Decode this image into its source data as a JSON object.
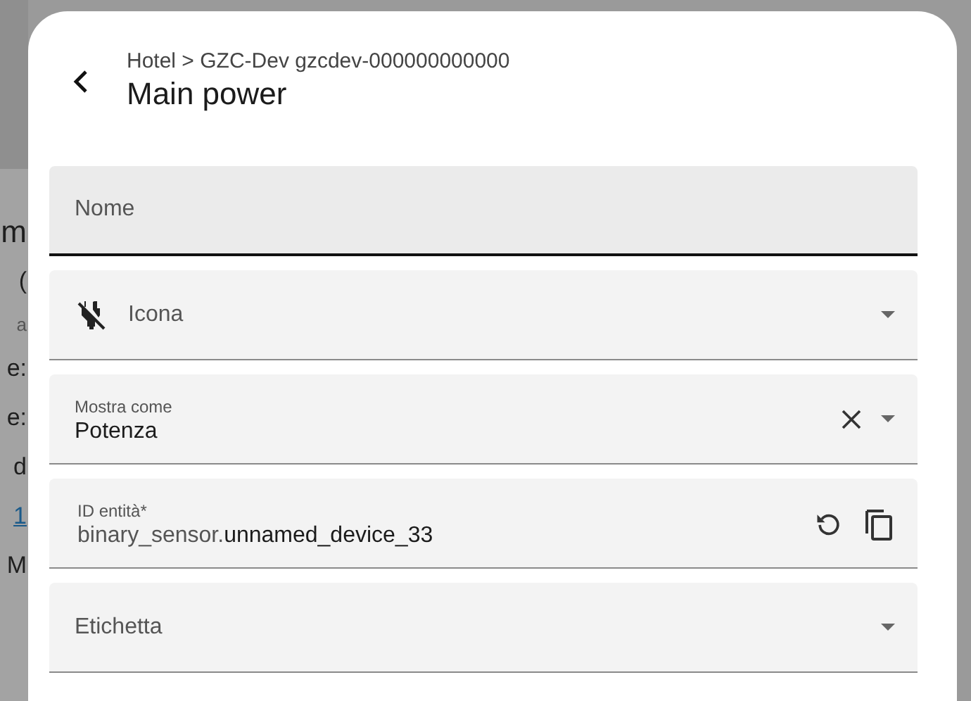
{
  "background_page": {
    "fragments": [
      {
        "text": "m",
        "kind": "heading"
      },
      {
        "text": "(",
        "kind": "text"
      },
      {
        "text": "a",
        "kind": "small"
      },
      {
        "text": "e:",
        "kind": "text"
      },
      {
        "text": "e:",
        "kind": "text"
      },
      {
        "text": "d",
        "kind": "text"
      },
      {
        "text": "1",
        "kind": "link"
      },
      {
        "text": "M",
        "kind": "text"
      }
    ]
  },
  "dialog": {
    "breadcrumb": "Hotel > GZC-Dev gzcdev-000000000000",
    "title": "Main power",
    "fields": [
      {
        "kind": "text",
        "label": "Nome",
        "focused": true
      },
      {
        "kind": "icon-picker",
        "label": "Icona"
      },
      {
        "kind": "select",
        "label": "Mostra come",
        "value": "Potenza",
        "clearable": true
      },
      {
        "kind": "entity-id",
        "label": "ID entità*",
        "value_prefix": "binary_sensor.",
        "value": "unnamed_device_33"
      },
      {
        "kind": "select",
        "label": "Etichetta",
        "clearable": false
      }
    ]
  }
}
